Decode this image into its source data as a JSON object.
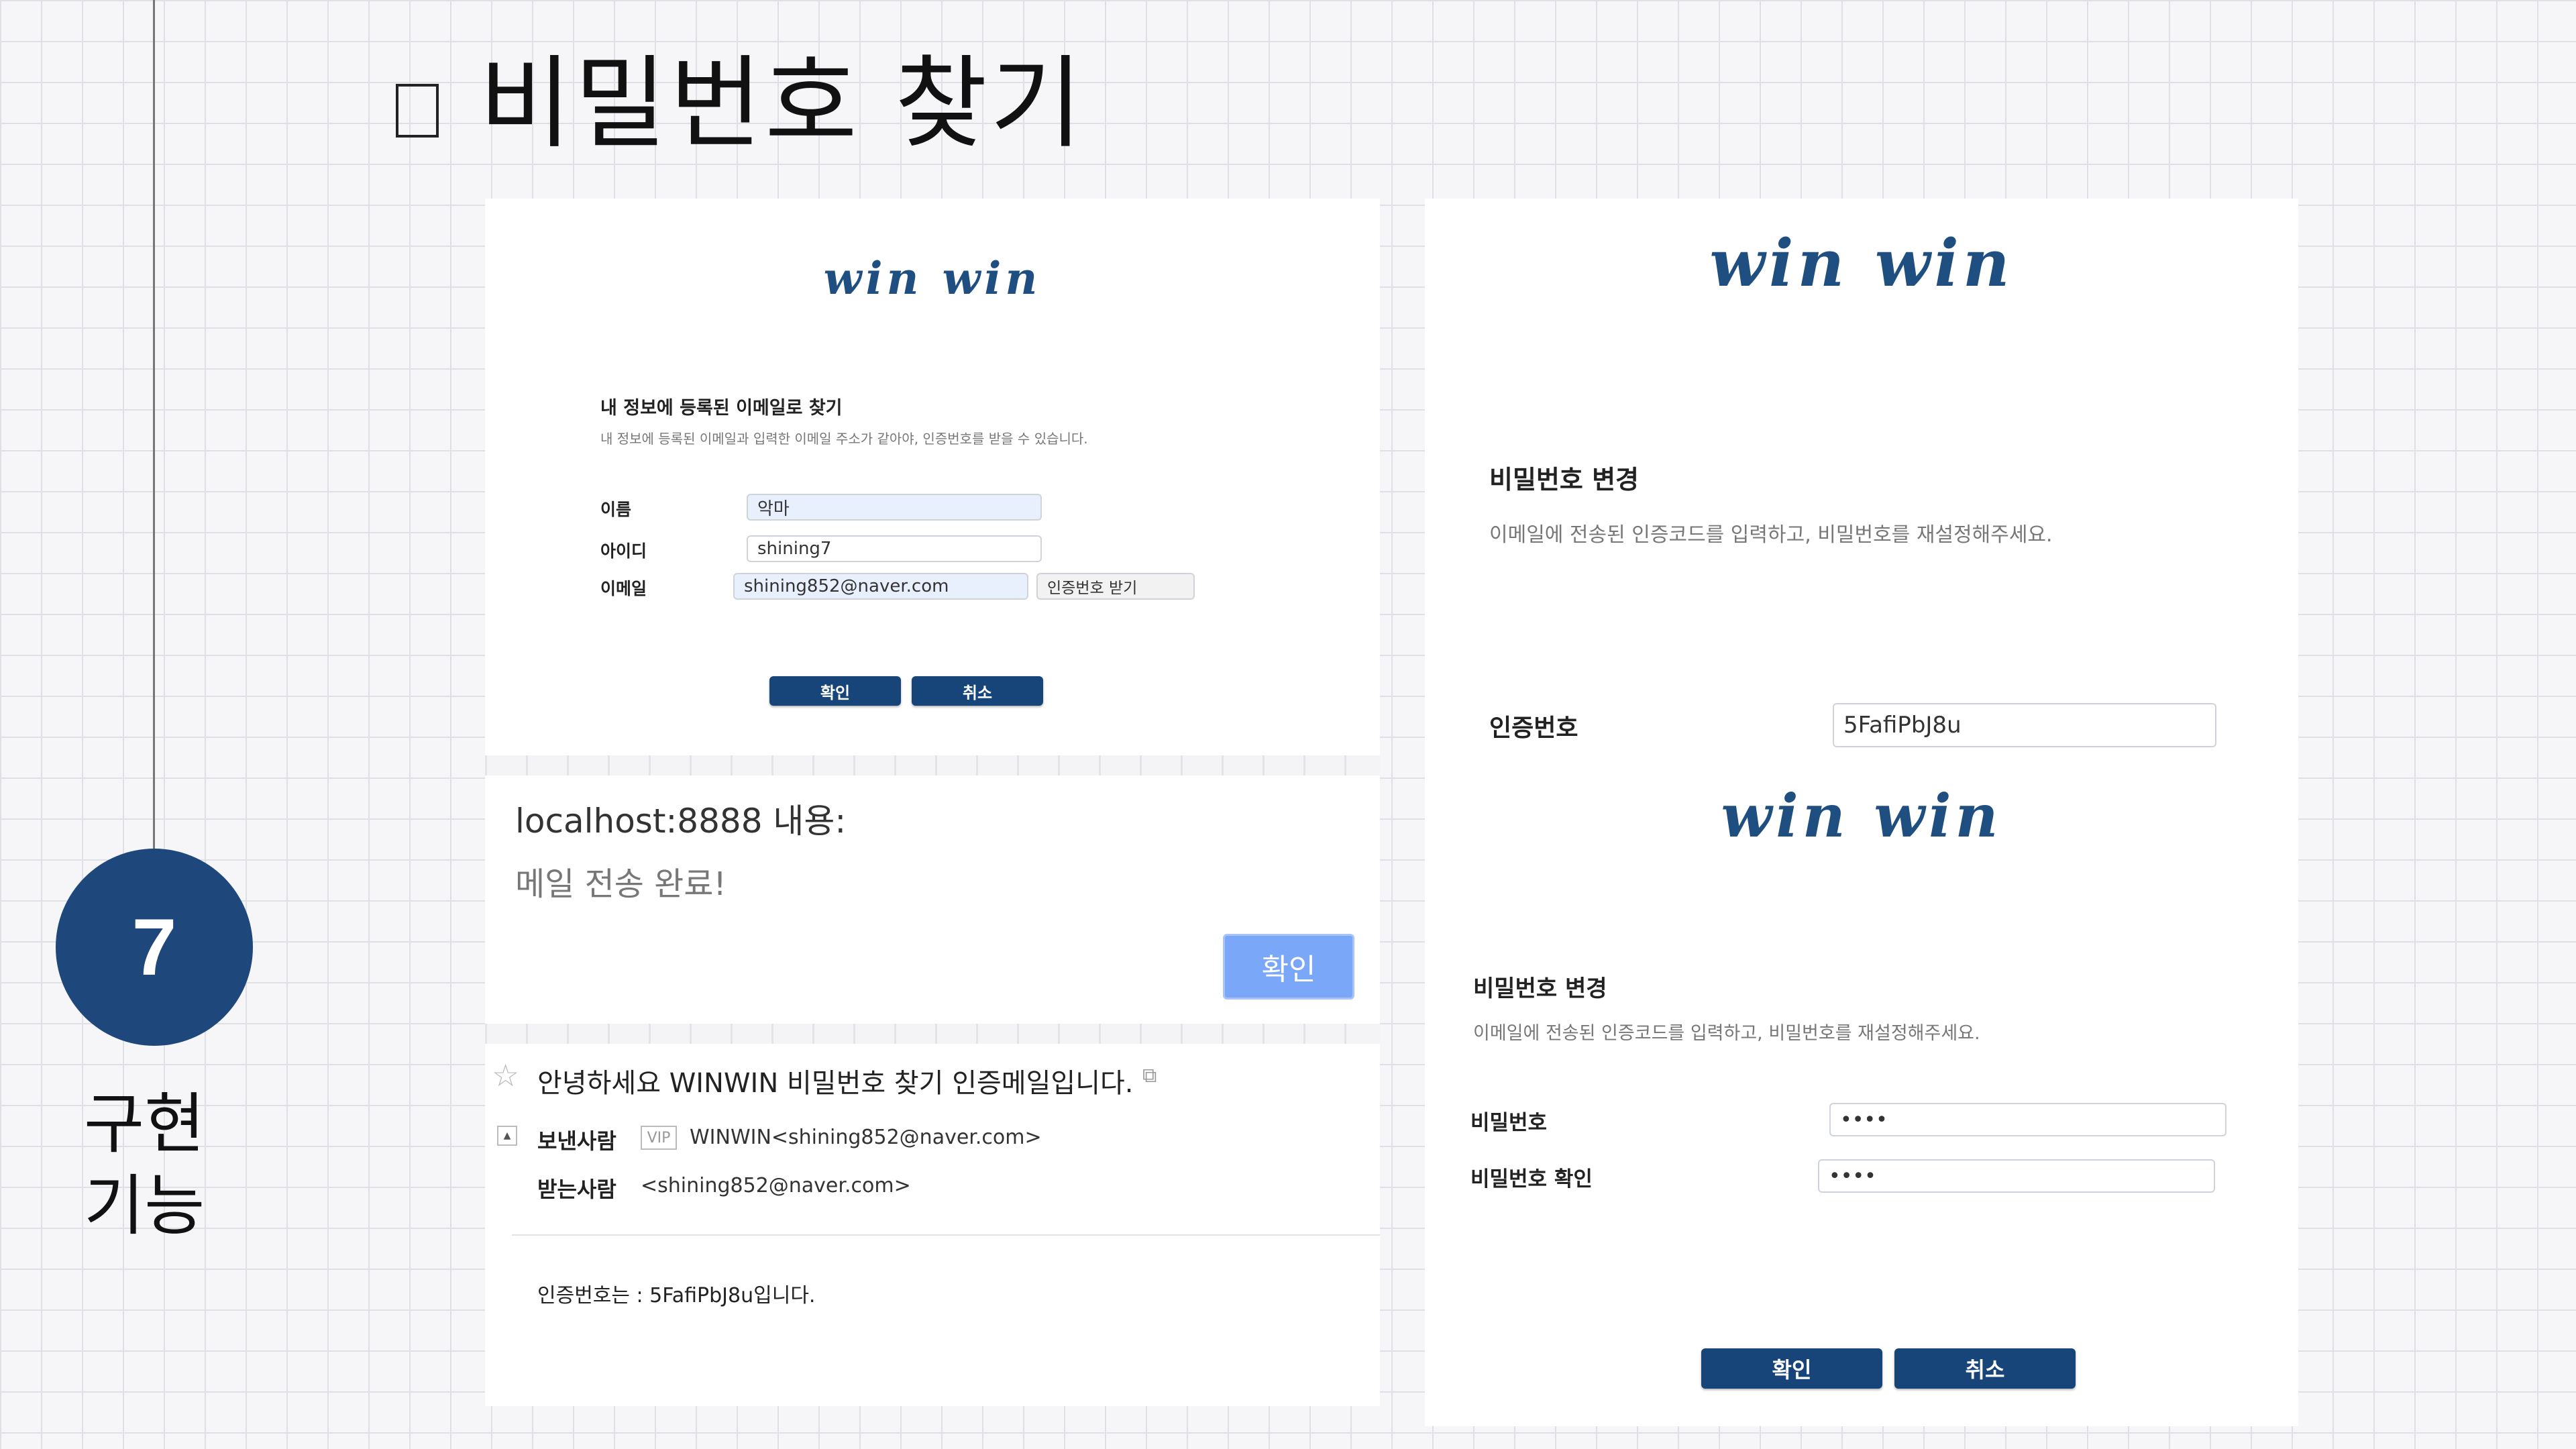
{
  "slide": {
    "title": "비밀번호 찾기",
    "badge_number": "7",
    "side_label_line1": "구현",
    "side_label_line2": "기능"
  },
  "find_form": {
    "logo": "win win",
    "heading": "내 정보에 등록된 이메일로 찾기",
    "description": "내 정보에 등록된 이메일과 입력한 이메일 주소가 같아야, 인증번호를 받을 수 있습니다.",
    "name_label": "이름",
    "name_value": "악마",
    "id_label": "아이디",
    "id_value": "shining7",
    "email_label": "이메일",
    "email_value": "shining852@naver.com",
    "send_code_button": "인증번호 받기",
    "confirm_button": "확인",
    "cancel_button": "취소"
  },
  "alert": {
    "title": "localhost:8888 내용:",
    "message": "메일 전송 완료!",
    "ok_button": "확인"
  },
  "email_view": {
    "subject": "안녕하세요 WINWIN 비밀번호 찾기 인증메일입니다.",
    "sender_label": "보낸사람",
    "vip_badge": "VIP",
    "sender_value": "WINWIN<shining852@naver.com>",
    "recipient_label": "받는사람",
    "recipient_value": "<shining852@naver.com>",
    "body": "인증번호는 : 5FafiPbJ8u입니다."
  },
  "verify_form": {
    "logo": "win win",
    "heading": "비밀번호 변경",
    "description": "이메일에 전송된 인증코드를 입력하고, 비밀번호를 재설정해주세요.",
    "code_label": "인증번호",
    "code_value": "5FafiPbJ8u"
  },
  "reset_form": {
    "logo": "win win",
    "heading": "비밀번호 변경",
    "description": "이메일에 전송된 인증코드를 입력하고, 비밀번호를 재설정해주세요.",
    "password_label": "비밀번호",
    "password_value": "••••",
    "password_confirm_label": "비밀번호 확인",
    "password_confirm_value": "••••",
    "confirm_button": "확인",
    "cancel_button": "취소"
  },
  "colors": {
    "primary": "#17457a",
    "badge": "#1e477b",
    "alert_button": "#7aa7f7",
    "logo": "#1f4f80"
  }
}
